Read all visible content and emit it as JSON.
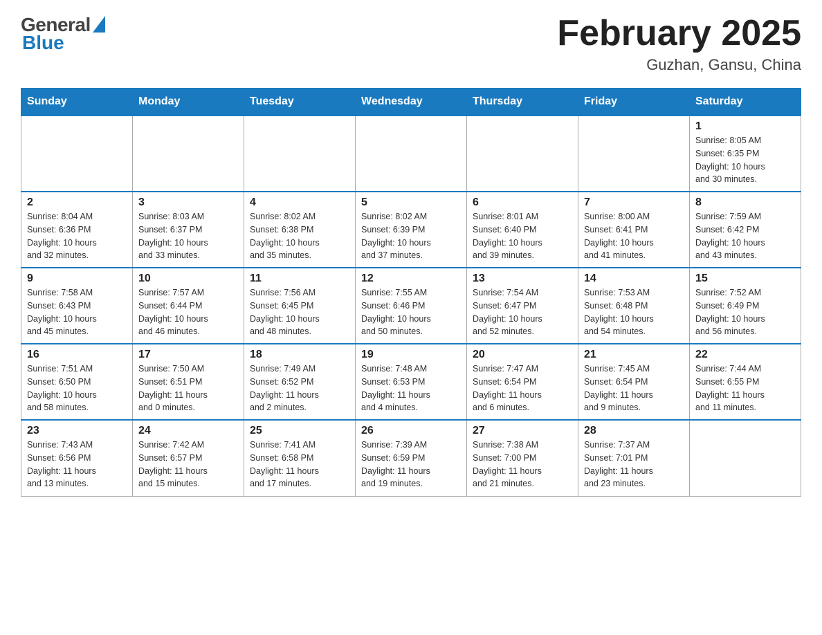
{
  "header": {
    "month_title": "February 2025",
    "location": "Guzhan, Gansu, China",
    "logo_general": "General",
    "logo_blue": "Blue"
  },
  "weekdays": [
    "Sunday",
    "Monday",
    "Tuesday",
    "Wednesday",
    "Thursday",
    "Friday",
    "Saturday"
  ],
  "weeks": [
    [
      {
        "day": "",
        "info": ""
      },
      {
        "day": "",
        "info": ""
      },
      {
        "day": "",
        "info": ""
      },
      {
        "day": "",
        "info": ""
      },
      {
        "day": "",
        "info": ""
      },
      {
        "day": "",
        "info": ""
      },
      {
        "day": "1",
        "info": "Sunrise: 8:05 AM\nSunset: 6:35 PM\nDaylight: 10 hours\nand 30 minutes."
      }
    ],
    [
      {
        "day": "2",
        "info": "Sunrise: 8:04 AM\nSunset: 6:36 PM\nDaylight: 10 hours\nand 32 minutes."
      },
      {
        "day": "3",
        "info": "Sunrise: 8:03 AM\nSunset: 6:37 PM\nDaylight: 10 hours\nand 33 minutes."
      },
      {
        "day": "4",
        "info": "Sunrise: 8:02 AM\nSunset: 6:38 PM\nDaylight: 10 hours\nand 35 minutes."
      },
      {
        "day": "5",
        "info": "Sunrise: 8:02 AM\nSunset: 6:39 PM\nDaylight: 10 hours\nand 37 minutes."
      },
      {
        "day": "6",
        "info": "Sunrise: 8:01 AM\nSunset: 6:40 PM\nDaylight: 10 hours\nand 39 minutes."
      },
      {
        "day": "7",
        "info": "Sunrise: 8:00 AM\nSunset: 6:41 PM\nDaylight: 10 hours\nand 41 minutes."
      },
      {
        "day": "8",
        "info": "Sunrise: 7:59 AM\nSunset: 6:42 PM\nDaylight: 10 hours\nand 43 minutes."
      }
    ],
    [
      {
        "day": "9",
        "info": "Sunrise: 7:58 AM\nSunset: 6:43 PM\nDaylight: 10 hours\nand 45 minutes."
      },
      {
        "day": "10",
        "info": "Sunrise: 7:57 AM\nSunset: 6:44 PM\nDaylight: 10 hours\nand 46 minutes."
      },
      {
        "day": "11",
        "info": "Sunrise: 7:56 AM\nSunset: 6:45 PM\nDaylight: 10 hours\nand 48 minutes."
      },
      {
        "day": "12",
        "info": "Sunrise: 7:55 AM\nSunset: 6:46 PM\nDaylight: 10 hours\nand 50 minutes."
      },
      {
        "day": "13",
        "info": "Sunrise: 7:54 AM\nSunset: 6:47 PM\nDaylight: 10 hours\nand 52 minutes."
      },
      {
        "day": "14",
        "info": "Sunrise: 7:53 AM\nSunset: 6:48 PM\nDaylight: 10 hours\nand 54 minutes."
      },
      {
        "day": "15",
        "info": "Sunrise: 7:52 AM\nSunset: 6:49 PM\nDaylight: 10 hours\nand 56 minutes."
      }
    ],
    [
      {
        "day": "16",
        "info": "Sunrise: 7:51 AM\nSunset: 6:50 PM\nDaylight: 10 hours\nand 58 minutes."
      },
      {
        "day": "17",
        "info": "Sunrise: 7:50 AM\nSunset: 6:51 PM\nDaylight: 11 hours\nand 0 minutes."
      },
      {
        "day": "18",
        "info": "Sunrise: 7:49 AM\nSunset: 6:52 PM\nDaylight: 11 hours\nand 2 minutes."
      },
      {
        "day": "19",
        "info": "Sunrise: 7:48 AM\nSunset: 6:53 PM\nDaylight: 11 hours\nand 4 minutes."
      },
      {
        "day": "20",
        "info": "Sunrise: 7:47 AM\nSunset: 6:54 PM\nDaylight: 11 hours\nand 6 minutes."
      },
      {
        "day": "21",
        "info": "Sunrise: 7:45 AM\nSunset: 6:54 PM\nDaylight: 11 hours\nand 9 minutes."
      },
      {
        "day": "22",
        "info": "Sunrise: 7:44 AM\nSunset: 6:55 PM\nDaylight: 11 hours\nand 11 minutes."
      }
    ],
    [
      {
        "day": "23",
        "info": "Sunrise: 7:43 AM\nSunset: 6:56 PM\nDaylight: 11 hours\nand 13 minutes."
      },
      {
        "day": "24",
        "info": "Sunrise: 7:42 AM\nSunset: 6:57 PM\nDaylight: 11 hours\nand 15 minutes."
      },
      {
        "day": "25",
        "info": "Sunrise: 7:41 AM\nSunset: 6:58 PM\nDaylight: 11 hours\nand 17 minutes."
      },
      {
        "day": "26",
        "info": "Sunrise: 7:39 AM\nSunset: 6:59 PM\nDaylight: 11 hours\nand 19 minutes."
      },
      {
        "day": "27",
        "info": "Sunrise: 7:38 AM\nSunset: 7:00 PM\nDaylight: 11 hours\nand 21 minutes."
      },
      {
        "day": "28",
        "info": "Sunrise: 7:37 AM\nSunset: 7:01 PM\nDaylight: 11 hours\nand 23 minutes."
      },
      {
        "day": "",
        "info": ""
      }
    ]
  ]
}
